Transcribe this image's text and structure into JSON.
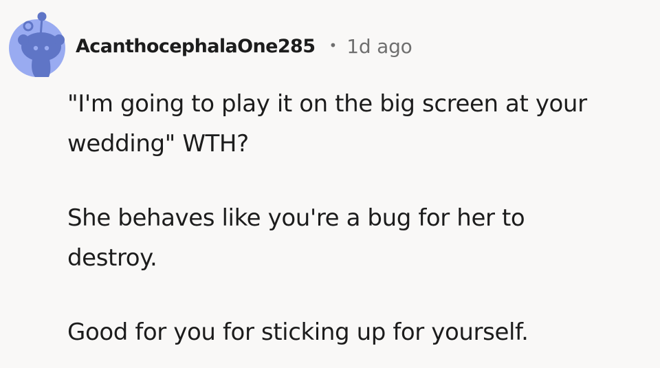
{
  "comment": {
    "author": "AcanthocephalaOne285",
    "separator": "•",
    "timestamp": "1d ago",
    "paragraphs": [
      "\"I'm going to play it on the big screen at your\nwedding\" WTH?",
      "She behaves like you're a bug for her to\ndestroy.",
      "Good for you for sticking up for yourself."
    ]
  },
  "icons": {
    "avatar": "reddit-snoo-avatar-icon"
  },
  "colors": {
    "background": "#f9f8f7",
    "avatar_bg": "#99abf1",
    "avatar_figure": "#5f75c6",
    "text": "#1c1c1c",
    "muted": "#6f6f6f"
  }
}
